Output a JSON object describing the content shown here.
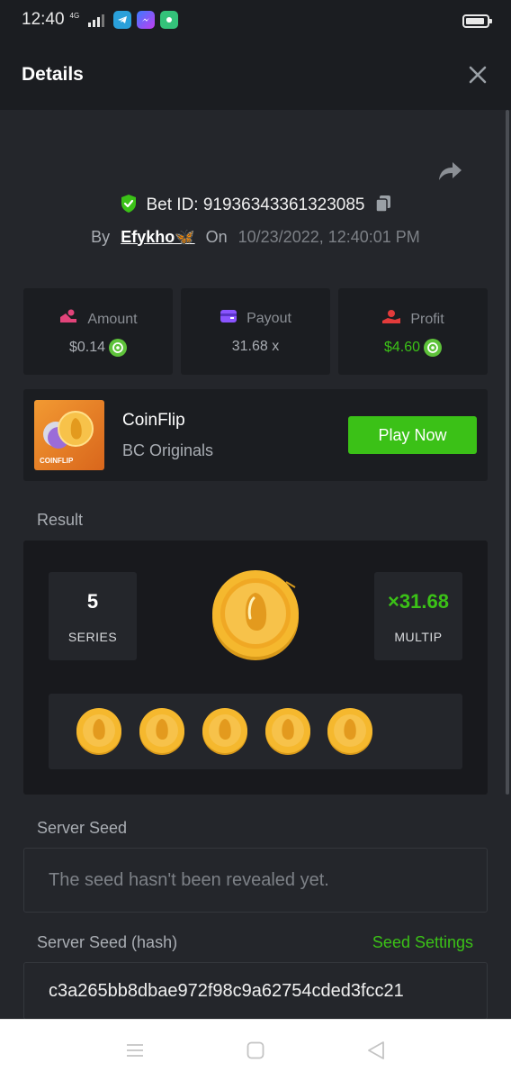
{
  "status_bar": {
    "time": "12:40",
    "network": "4G"
  },
  "header": {
    "title": "Details"
  },
  "bet": {
    "id_label": "Bet ID: 91936343361323085",
    "by_label": "By",
    "username": "Efykho🦋",
    "on_label": "On",
    "datetime": "10/23/2022, 12:40:01 PM"
  },
  "stats": {
    "amount_label": "Amount",
    "amount_value": "$0.14",
    "payout_label": "Payout",
    "payout_value": "31.68 x",
    "profit_label": "Profit",
    "profit_value": "$4.60"
  },
  "game": {
    "thumb_label": "COINFLIP",
    "name": "CoinFlip",
    "provider": "BC Originals",
    "play_label": "Play Now"
  },
  "result": {
    "section_label": "Result",
    "series_value": "5",
    "series_label": "SERIES",
    "multip_value": "×31.68",
    "multip_label": "MULTIP",
    "coin_count": 5
  },
  "server_seed": {
    "label": "Server Seed",
    "value": "The seed hasn't been revealed yet."
  },
  "server_seed_hash": {
    "label": "Server Seed (hash)",
    "settings_link": "Seed Settings",
    "value": "c3a265bb8dbae972f98c9a62754cded3fcc21"
  },
  "colors": {
    "accent_green": "#3bc117",
    "background": "#24262b",
    "panel": "#1b1d21",
    "coin_gold": "#f5b82e"
  }
}
